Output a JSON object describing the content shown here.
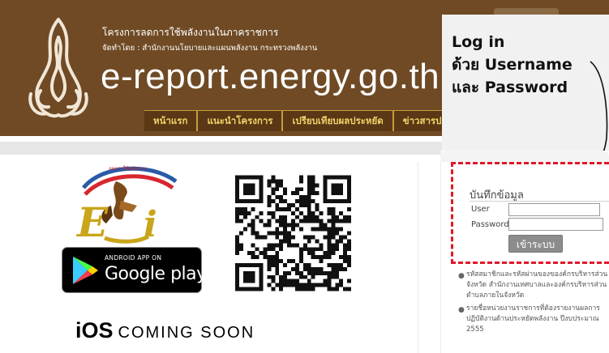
{
  "header": {
    "title_line": "โครงการลดการใช้พลังงานในภาคราชการ",
    "subtitle_line": "จัดทำโดย : สำนักงานนโยบายและแผนพลังงาน กระทรวงพลังงาน",
    "site_name": "e-report.energy.go.th",
    "nav": [
      "หน้าแรก",
      "แนะนำโครงการ",
      "เปรียบเทียบผลประหยัด",
      "ข่าวสารประ"
    ]
  },
  "apps": {
    "google_play_top": "ANDROID APP ON",
    "google_play_main": "Google play",
    "eui_text": "EUi",
    "ios_label": "iOS",
    "ios_coming": "COMING SOON"
  },
  "annotation": {
    "lines": [
      "Log in",
      "ด้วย Username",
      "และ Password"
    ],
    "highlight_color": "#e0182a"
  },
  "login": {
    "title": "บันทึกข้อมูล",
    "user_label": "User",
    "password_label": "Password",
    "button_label": "เข้าระบบ"
  },
  "notes": [
    "รหัสสมาชิกและรหัสผ่านของของค์กรบริหารส่วนจังหวัด สำนักงานเทศบาลและองค์กรบริหารส่วนตำบลภายในจังหวัด",
    "รายชื่อหน่วยงานราชการที่ต้องรายงานผลการปฏิบัติงานด้านประหยัดพลังงาน ปีงบประมาณ 2555"
  ],
  "colors": {
    "header_brown": "#6f4a24",
    "nav_text": "#f3d46a",
    "button_gray": "#8c8c8c"
  }
}
